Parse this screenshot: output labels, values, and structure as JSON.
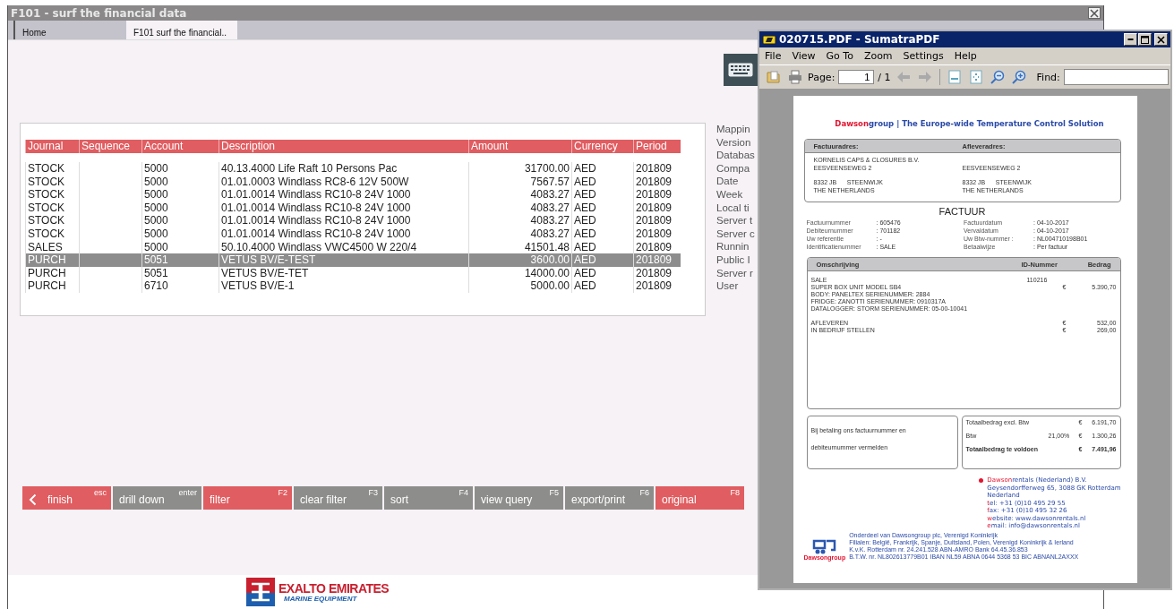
{
  "window": {
    "title": "F101 - surf the financial data"
  },
  "tabs": [
    {
      "label": "Home",
      "selected": false
    },
    {
      "label": "F101 surf the financial..",
      "selected": true
    }
  ],
  "table": {
    "columns": [
      "Journal",
      "Sequence",
      "Account",
      "Description",
      "Amount",
      "Currency",
      "Period"
    ],
    "rows": [
      {
        "journal": "STOCK",
        "account": "5000",
        "description": "40.13.4000 Life Raft 10 Persons Pac",
        "amount": "31700.00",
        "currency": "AED",
        "period": "201809",
        "selected": false
      },
      {
        "journal": "STOCK",
        "account": "5000",
        "description": "01.01.0003 Windlass RC8-6 12V 500W",
        "amount": "7567.57",
        "currency": "AED",
        "period": "201809",
        "selected": false
      },
      {
        "journal": "STOCK",
        "account": "5000",
        "description": "01.01.0014 Windlass RC10-8 24V 1000",
        "amount": "4083.27",
        "currency": "AED",
        "period": "201809",
        "selected": false
      },
      {
        "journal": "STOCK",
        "account": "5000",
        "description": "01.01.0014 Windlass RC10-8 24V 1000",
        "amount": "4083.27",
        "currency": "AED",
        "period": "201809",
        "selected": false
      },
      {
        "journal": "STOCK",
        "account": "5000",
        "description": "01.01.0014 Windlass RC10-8 24V 1000",
        "amount": "4083.27",
        "currency": "AED",
        "period": "201809",
        "selected": false
      },
      {
        "journal": "STOCK",
        "account": "5000",
        "description": "01.01.0014 Windlass RC10-8 24V 1000",
        "amount": "4083.27",
        "currency": "AED",
        "period": "201809",
        "selected": false
      },
      {
        "journal": "SALES",
        "account": "5000",
        "description": "50.10.4000 Windlass VWC4500 W 220/4",
        "amount": "41501.48",
        "currency": "AED",
        "period": "201809",
        "selected": false
      },
      {
        "journal": "PURCH",
        "account": "5051",
        "description": "VETUS BV/E-TEST",
        "amount": "3600.00",
        "currency": "AED",
        "period": "201809",
        "selected": true
      },
      {
        "journal": "PURCH",
        "account": "5051",
        "description": "VETUS BV/E-TET",
        "amount": "14000.00",
        "currency": "AED",
        "period": "201809",
        "selected": false
      },
      {
        "journal": "PURCH",
        "account": "6710",
        "description": "VETUS BV/E-1",
        "amount": "5000.00",
        "currency": "AED",
        "period": "201809",
        "selected": false
      }
    ]
  },
  "info_labels": [
    "Mappin",
    "Version",
    "Databas",
    "Compa",
    "Date",
    "Week",
    "Local ti",
    "Server t",
    "Server c",
    "Runnin",
    "Public I",
    "Server r",
    "User"
  ],
  "function_keys": [
    {
      "label": "finish",
      "key": "esc",
      "kind": "back",
      "highlighted": true
    },
    {
      "label": "drill down",
      "key": "enter",
      "kind": "plain",
      "highlighted": false
    },
    {
      "label": "filter",
      "key": "F2",
      "kind": "plain",
      "highlighted": true
    },
    {
      "label": "clear filter",
      "key": "F3",
      "kind": "plain",
      "highlighted": false
    },
    {
      "label": "sort",
      "key": "F4",
      "kind": "plain",
      "highlighted": false
    },
    {
      "label": "view query",
      "key": "F5",
      "kind": "plain",
      "highlighted": false
    },
    {
      "label": "export/print",
      "key": "F6",
      "kind": "plain",
      "highlighted": false
    },
    {
      "label": "original",
      "key": "F8",
      "kind": "plain",
      "highlighted": true
    }
  ],
  "logo": {
    "name": "EXALTO EMIRATES",
    "tagline": "MARINE EQUIPMENT"
  },
  "pdf_viewer": {
    "title": "020715.PDF - SumatraPDF",
    "menu": [
      "File",
      "View",
      "Go To",
      "Zoom",
      "Settings",
      "Help"
    ],
    "page_label": "Page:",
    "page_value": "1",
    "page_total": "/ 1",
    "find_label": "Find:",
    "document": {
      "brand_red": "Dawson",
      "brand_blue": "group",
      "separator": "|",
      "slogan": "The Europe-wide Temperature Control Solution",
      "billing_heading": "Factuuradres:",
      "delivery_heading": "Afleveradres:",
      "billing": {
        "name": "KORNELIS CAPS & CLOSURES B.V.",
        "street": "EESVEENSEWEG 2",
        "postcode": "8332 JB",
        "city": "STEENWIJK",
        "country": "THE NETHERLANDS"
      },
      "delivery": {
        "street": "EESVEENSEWEG 2",
        "postcode": "8332 JB",
        "city": "STEENWIJK",
        "country": "THE NETHERLANDS"
      },
      "title": "FACTUUR",
      "details_left": [
        {
          "label": "Factuurnummer",
          "value": ": 605476"
        },
        {
          "label": "Debiteurnummer",
          "value": ": 701182"
        },
        {
          "label": "Uw referentie",
          "value": ": -"
        },
        {
          "label": "Identificatienummer",
          "value": ": SALE"
        }
      ],
      "details_right": [
        {
          "label": "Factuurdatum",
          "value": ": 04-10-2017"
        },
        {
          "label": "Vervaldatum",
          "value": ": 04-10-2017"
        },
        {
          "label": "Uw Btw-nummer :",
          "value": ": NL004710198B01"
        },
        {
          "label": "Betaalwijze",
          "value": ": Per factuur"
        }
      ],
      "items_columns": [
        "Omschrijving",
        "ID-Nummer",
        "Bedrag"
      ],
      "item_groups": [
        [
          {
            "text": "SALE",
            "id": "110216"
          },
          {
            "text": "SUPER BOX UNIT MODEL SB4",
            "currency": "€",
            "amount": "5.390,70"
          },
          {
            "text": "BODY: PANELTEX SERIENUMMER: 2884"
          },
          {
            "text": "FRIDGE: ZANOTTI SERIENUMMER: 0910317A"
          },
          {
            "text": "DATALOGGER: STORM SERIENUMMER: 05-00-10041"
          }
        ],
        [
          {
            "text": "AFLEVEREN",
            "currency": "€",
            "amount": "532,00"
          },
          {
            "text": "IN BEDRIJF STELLEN",
            "currency": "€",
            "amount": "269,00"
          }
        ]
      ],
      "payment_note": "Bij betaling ons factuurnummer en debiteurnummer vermelden",
      "totals": [
        {
          "label": "Totaalbedrag excl. Btw",
          "currency": "€",
          "amount": "6.191,70",
          "bold": false
        },
        {
          "label": "Btw",
          "rate": "21,00%",
          "currency": "€",
          "amount": "1.300,26",
          "bold": false
        },
        {
          "label": "Totaalbedrag te voldoen",
          "currency": "€",
          "amount": "7.491,96",
          "bold": true
        }
      ],
      "footer_logo": "Dawsongroup",
      "footer_lines": [
        "Onderdeel van Dawsongroup plc, Verenigd Koninkrijk",
        "Filialen: België, Frankrijk, Spanje, Duitsland, Polen, Verenigd Koninkrijk & Ierland",
        "K.v.K. Rotterdam nr. 24.241.528   ABN-AMRO Bank 64.45.36.853",
        "B.T.W. nr. NL802613779B01  IBAN NL59 ABNA 0644 5368 53  BIC ABNANL2AXXX"
      ],
      "contact": [
        {
          "red": "Dawson",
          "blue": "rentals (Nederland) B.V."
        },
        {
          "blue": "Geysendorfferweg 65, 3088 GK  Rotterdam"
        },
        {
          "blue": "Nederland"
        },
        {
          "red": "t",
          "blue": "el:  +31 (0)10 495 29 55"
        },
        {
          "red": "f",
          "blue": "ax: +31 (0)10 495 32 26"
        },
        {
          "red": "w",
          "blue": "ebsite: www.dawsonrentals.nl"
        },
        {
          "red": "e",
          "blue": "mail: info@dawsonrentals.nl"
        }
      ]
    }
  }
}
